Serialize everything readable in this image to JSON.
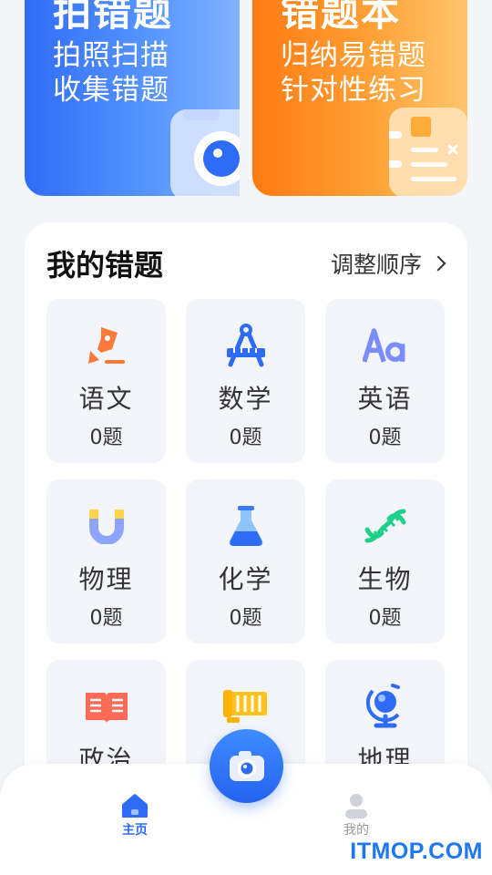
{
  "banners": [
    {
      "title": "拍错题",
      "sub_lines": [
        "拍照扫描",
        "收集错题"
      ]
    },
    {
      "title": "错题本",
      "sub_lines": [
        "归纳易错题",
        "针对性练习"
      ]
    }
  ],
  "card": {
    "title": "我的错题",
    "action": "调整顺序"
  },
  "subjects": [
    {
      "name": "语文",
      "count": "0题",
      "icon": "pen-icon"
    },
    {
      "name": "数学",
      "count": "0题",
      "icon": "compass-icon"
    },
    {
      "name": "英语",
      "count": "0题",
      "icon": "letters-aa-icon"
    },
    {
      "name": "物理",
      "count": "0题",
      "icon": "magnet-icon"
    },
    {
      "name": "化学",
      "count": "0题",
      "icon": "flask-icon"
    },
    {
      "name": "生物",
      "count": "0题",
      "icon": "dna-icon"
    },
    {
      "name": "政治",
      "count": "",
      "icon": "book-icon"
    },
    {
      "name": "",
      "count": "",
      "icon": "scroll-icon"
    },
    {
      "name": "地理",
      "count": "",
      "icon": "globe-icon"
    }
  ],
  "nav": {
    "home": "主页",
    "mine": "我的"
  },
  "watermark": "ITMOP.COM",
  "colors": {
    "primary": "#2f6cf6",
    "orange": "#ff7a12",
    "green": "#1fd08a"
  }
}
